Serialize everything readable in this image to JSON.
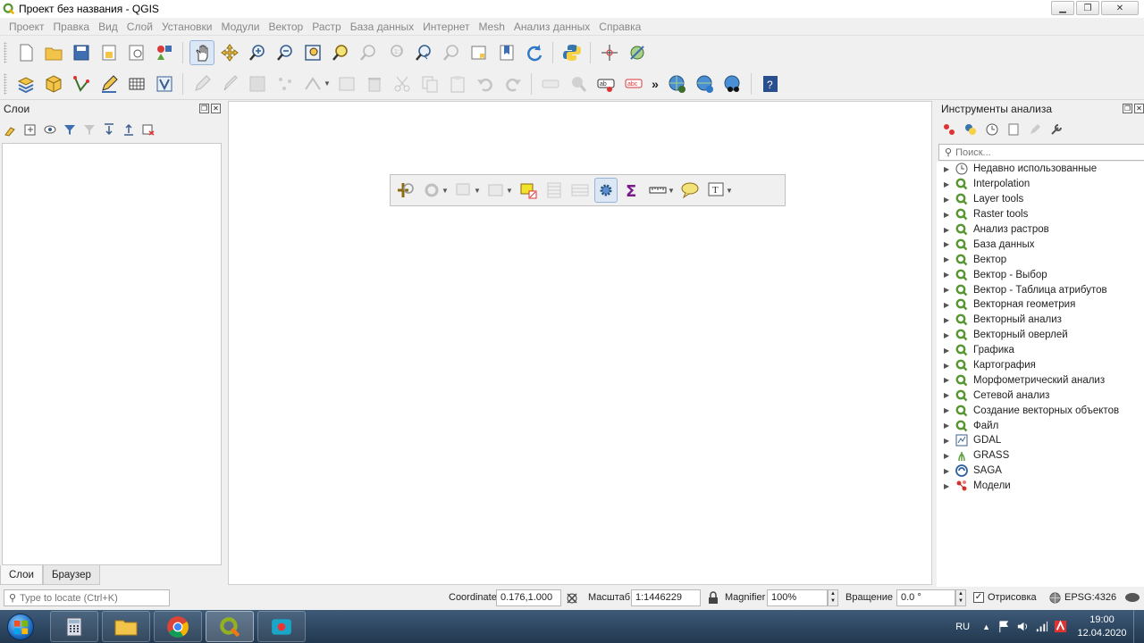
{
  "window": {
    "title": "Проект без названия - QGIS",
    "min": "▁",
    "max": "❐",
    "close": "✕"
  },
  "menu": [
    "Проект",
    "Правка",
    "Вид",
    "Слой",
    "Установки",
    "Модули",
    "Вектор",
    "Растр",
    "База данных",
    "Интернет",
    "Mesh",
    "Анализ данных",
    "Справка"
  ],
  "layers_panel": {
    "title": "Слои",
    "tabs": [
      "Слои",
      "Браузер"
    ]
  },
  "processing_panel": {
    "title": "Инструменты анализа",
    "search_placeholder": "Поиск...",
    "items": [
      {
        "label": "Недавно использованные",
        "icon": "clock-icon"
      },
      {
        "label": "Interpolation",
        "icon": "qgis-icon"
      },
      {
        "label": "Layer tools",
        "icon": "qgis-icon"
      },
      {
        "label": "Raster tools",
        "icon": "qgis-icon"
      },
      {
        "label": "Анализ растров",
        "icon": "qgis-icon"
      },
      {
        "label": "База данных",
        "icon": "qgis-icon"
      },
      {
        "label": "Вектор",
        "icon": "qgis-icon"
      },
      {
        "label": "Вектор - Выбор",
        "icon": "qgis-icon"
      },
      {
        "label": "Вектор - Таблица атрибутов",
        "icon": "qgis-icon"
      },
      {
        "label": "Векторная геометрия",
        "icon": "qgis-icon"
      },
      {
        "label": "Векторный анализ",
        "icon": "qgis-icon"
      },
      {
        "label": "Векторный оверлей",
        "icon": "qgis-icon"
      },
      {
        "label": "Графика",
        "icon": "qgis-icon"
      },
      {
        "label": "Картография",
        "icon": "qgis-icon"
      },
      {
        "label": "Морфометрический анализ",
        "icon": "qgis-icon"
      },
      {
        "label": "Сетевой анализ",
        "icon": "qgis-icon"
      },
      {
        "label": "Создание векторных объектов",
        "icon": "qgis-icon"
      },
      {
        "label": "Файл",
        "icon": "qgis-icon"
      },
      {
        "label": "GDAL",
        "icon": "gdal-icon"
      },
      {
        "label": "GRASS",
        "icon": "grass-icon"
      },
      {
        "label": "SAGA",
        "icon": "saga-icon"
      },
      {
        "label": "Модели",
        "icon": "models-icon"
      }
    ]
  },
  "statusbar": {
    "locate_placeholder": "Type to locate (Ctrl+K)",
    "coordinate_label": "Coordinate",
    "coordinate_value": "0.176,1.000",
    "scale_label": "Масштаб",
    "scale_value": "1:1446229",
    "magnifier_label": "Magnifier",
    "magnifier_value": "100%",
    "rotation_label": "Вращение",
    "rotation_value": "0.0 °",
    "render_label": "Отрисовка",
    "render_checked": "✓",
    "crs": "EPSG:4326"
  },
  "taskbar": {
    "language": "RU",
    "time": "19:00",
    "date": "12.04.2020"
  },
  "colors": {
    "accent": "#589632",
    "taskbar": "#2c4661"
  }
}
